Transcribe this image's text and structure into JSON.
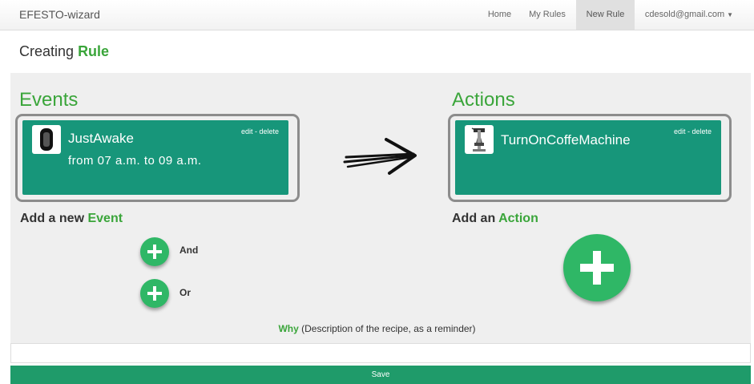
{
  "navbar": {
    "brand": "EFESTO-wizard",
    "items": [
      {
        "label": "Home"
      },
      {
        "label": "My Rules"
      },
      {
        "label": "New Rule",
        "active": true
      },
      {
        "label": "cdesold@gmail.com"
      }
    ]
  },
  "page": {
    "title_prefix": "Creating",
    "title_accent": "Rule"
  },
  "events": {
    "title": "Events",
    "card": {
      "name": "JustAwake",
      "detail": "from 07 a.m. to 09 a.m.",
      "edit": "edit",
      "separator": " - ",
      "delete": "delete",
      "icon": "wristband-icon"
    },
    "add_prefix": "Add a new",
    "add_accent": "Event",
    "and_label": "And",
    "or_label": "Or"
  },
  "actions": {
    "title": "Actions",
    "card": {
      "name": "TurnOnCoffeMachine",
      "edit": "edit",
      "separator": " - ",
      "delete": "delete",
      "icon": "coffee-machine-icon"
    },
    "add_prefix": "Add an",
    "add_accent": "Action"
  },
  "why": {
    "accent": "Why",
    "text": "(Description of the recipe, as a reminder)",
    "value": ""
  },
  "save_label": "Save",
  "colors": {
    "accent_green": "#3aa53a",
    "card_teal": "#17967a",
    "plus_green": "#2fb766",
    "save_green": "#1f9b6a"
  }
}
